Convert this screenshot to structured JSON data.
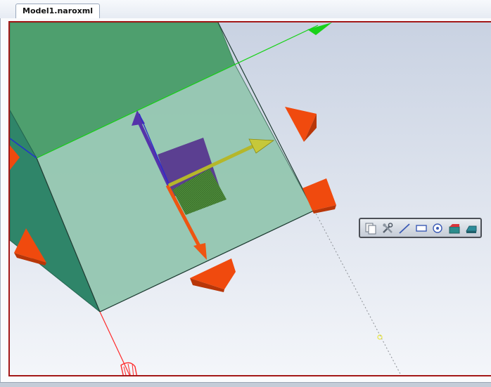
{
  "document_tabs": [
    {
      "label": "Model1.naroxml",
      "active": true
    }
  ],
  "viewport": {
    "frame_color": "#a31818",
    "background_top": "#c9d2e2",
    "background_bottom": "#f4f6fa"
  },
  "model": {
    "top_face_color": "#4e9f6e",
    "side_face_color": "#2f8569",
    "front_face_color": "#93c6b0",
    "inner_block_color": "#5b3f91",
    "inner_shadow_color": "#4d8a3a",
    "axis_x_color": "#ff2a2a",
    "axis_y_color": "#19d219",
    "axis_z_color": "#2233cc"
  },
  "manipulator": {
    "normal_arrow_color": "#b5b72a",
    "blue_arrow_color": "#5533aa",
    "orange_arrow_color": "#ee5511",
    "handle_color": "#f04a0e"
  },
  "mini_toolbar": {
    "tools": [
      {
        "icon": "copy-icon",
        "tooltip": ""
      },
      {
        "icon": "tools-icon",
        "tooltip": ""
      },
      {
        "icon": "line-icon",
        "tooltip": ""
      },
      {
        "icon": "rectangle-icon",
        "tooltip": ""
      },
      {
        "icon": "circle-icon",
        "tooltip": ""
      },
      {
        "icon": "extrude-icon",
        "tooltip": ""
      },
      {
        "icon": "plane-icon",
        "tooltip": ""
      }
    ]
  }
}
